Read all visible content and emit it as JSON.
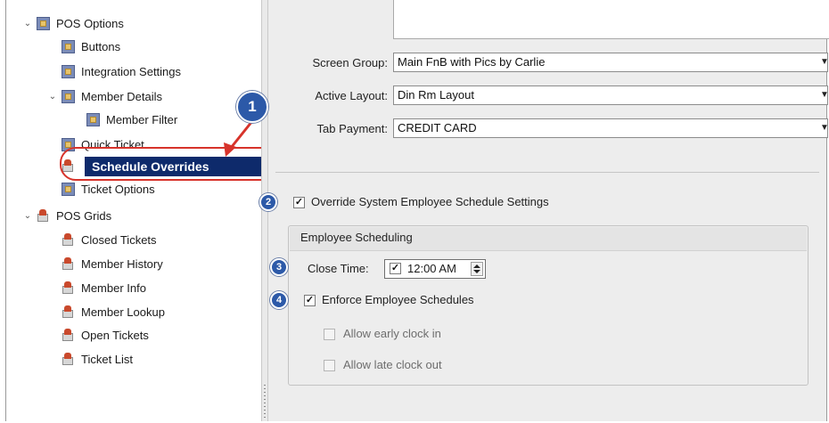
{
  "tree": {
    "pos_options": "POS Options",
    "buttons": "Buttons",
    "integration_settings": "Integration Settings",
    "member_details": "Member Details",
    "member_filter": "Member Filter",
    "quick_ticket": "Quick Ticket",
    "schedule_overrides": "Schedule Overrides",
    "ticket_options": "Ticket Options",
    "pos_grids": "POS Grids",
    "closed_tickets": "Closed Tickets",
    "member_history": "Member History",
    "member_info": "Member Info",
    "member_lookup": "Member Lookup",
    "open_tickets": "Open Tickets",
    "ticket_list": "Ticket List"
  },
  "form": {
    "screen_group_label": "Screen Group:",
    "screen_group_value": "Main FnB with Pics by Carlie",
    "active_layout_label": "Active Layout:",
    "active_layout_value": "Din Rm Layout",
    "tab_payment_label": "Tab Payment:",
    "tab_payment_value": "CREDIT CARD",
    "override_label": "Override System Employee Schedule Settings",
    "group_title": "Employee Scheduling",
    "close_time_label": "Close Time:",
    "close_time_value": "12:00 AM",
    "enforce_label": "Enforce Employee Schedules",
    "early_clock_label": "Allow early clock in",
    "late_clock_label": "Allow late clock out"
  },
  "callouts": [
    "1",
    "2",
    "3",
    "4"
  ],
  "colors": {
    "selection": "#0e2a6b",
    "highlight_ring": "#d7332b",
    "callout": "#2c59a8"
  }
}
